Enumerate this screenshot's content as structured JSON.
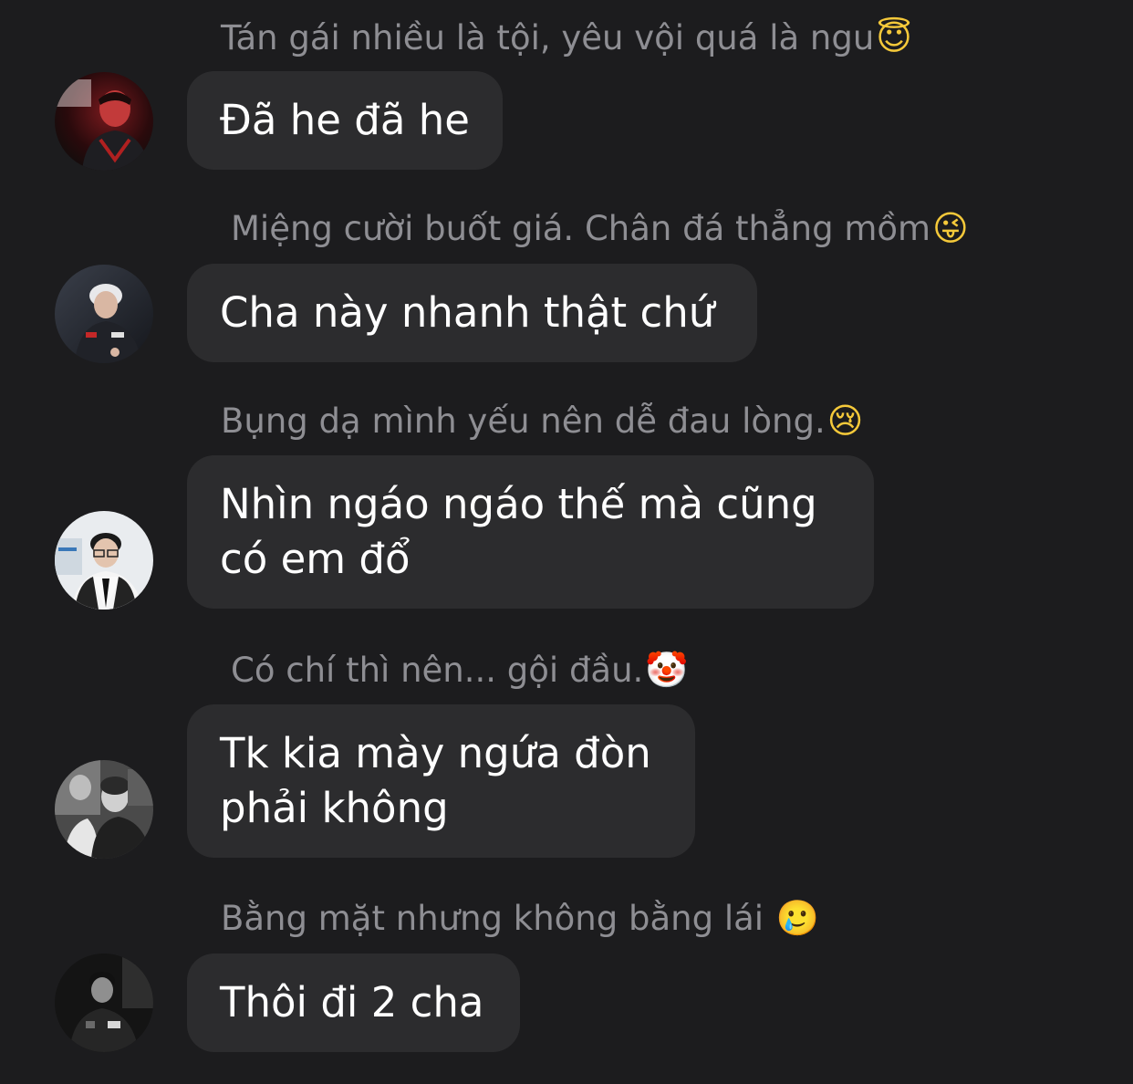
{
  "messages": [
    {
      "sender_name": "Tán gái nhiều là tội, yêu vội quá là ngu",
      "sender_emoji": "😇",
      "emoji_icon": "smiling-face-with-halo-icon",
      "text": "Đã he đã he",
      "avatar_icon": "avatar-red-lit-player-icon"
    },
    {
      "sender_name": "Miệng cười buốt giá. Chân đá thẳng mồm",
      "sender_emoji": "😜",
      "emoji_icon": "winking-face-with-tongue-icon",
      "text": " Cha này nhanh thật chứ",
      "avatar_icon": "avatar-white-hair-player-icon"
    },
    {
      "sender_name": "Bụng dạ mình yếu nên dễ đau lòng.",
      "sender_emoji": "😢",
      "emoji_icon": "crying-face-icon",
      "text": "Nhìn ngáo ngáo thế mà cũng\ncó em đổ",
      "avatar_icon": "avatar-glasses-suit-icon"
    },
    {
      "sender_name": "Có chí thì nên... gội đầu.",
      "sender_emoji": "🤡",
      "emoji_icon": "clown-face-icon",
      "text": "Tk kia mày ngứa đòn\nphải không",
      "avatar_icon": "avatar-grayscale-crowd-icon"
    },
    {
      "sender_name": "Bằng mặt nhưng không bằng lái ",
      "sender_emoji": "🥲",
      "emoji_icon": "smiling-face-with-tear-icon",
      "text": "Thôi đi 2 cha",
      "avatar_icon": "avatar-dark-jersey-player-icon"
    }
  ],
  "colors": {
    "background": "#1c1c1e",
    "bubble": "#2c2c2e",
    "name_text": "#8e8e93",
    "message_text": "#ffffff"
  }
}
